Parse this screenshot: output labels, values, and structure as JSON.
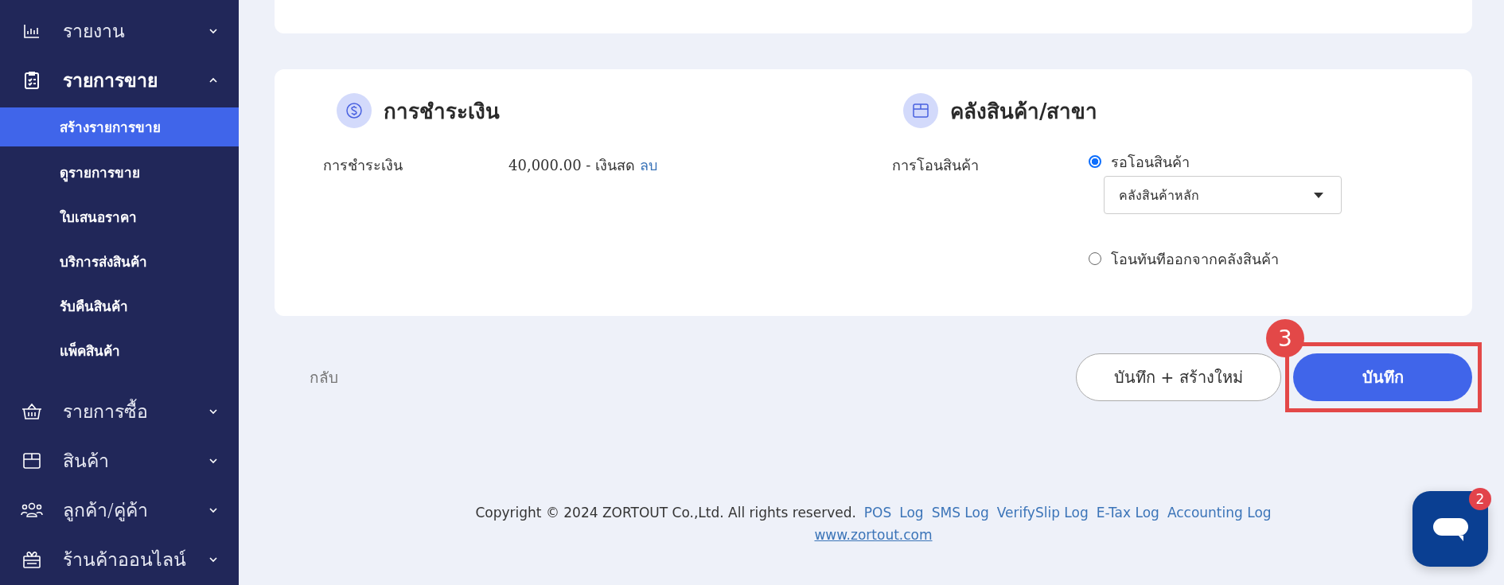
{
  "sidebar": {
    "items": [
      {
        "label": "รายงาน",
        "expanded": false
      },
      {
        "label": "รายการขาย",
        "expanded": true,
        "children": [
          {
            "label": "สร้างรายการขาย",
            "selected": true
          },
          {
            "label": "ดูรายการขาย",
            "selected": false
          },
          {
            "label": "ใบเสนอราคา",
            "selected": false
          },
          {
            "label": "บริการส่งสินค้า",
            "selected": false
          },
          {
            "label": "รับคืนสินค้า",
            "selected": false
          },
          {
            "label": "แพ็คสินค้า",
            "selected": false
          }
        ]
      },
      {
        "label": "รายการซื้อ",
        "expanded": false
      },
      {
        "label": "สินค้า",
        "expanded": false
      },
      {
        "label": "ลูกค้า/คู่ค้า",
        "expanded": false
      },
      {
        "label": "ร้านค้าออนไลน์",
        "expanded": false
      }
    ]
  },
  "payment": {
    "title": "การชำระเงิน",
    "label": "การชำระเงิน",
    "value": "40,000.00 - เงินสด",
    "delete_link": "ลบ"
  },
  "warehouse": {
    "title": "คลังสินค้า/สาขา",
    "label": "การโอนสินค้า",
    "options": [
      {
        "label": "รอโอนสินค้า",
        "selected": true,
        "select_value": "คลังสินค้าหลัก"
      },
      {
        "label": "โอนทันทีออกจากคลังสินค้า",
        "selected": false
      }
    ]
  },
  "actions": {
    "back": "กลับ",
    "save_new": "บันทึก + สร้างใหม่",
    "save": "บันทึก",
    "step_badge": "3"
  },
  "footer": {
    "copyright": "Copyright © 2024 ZORTOUT Co.,Ltd. All rights reserved.",
    "links": [
      "POS",
      "Log",
      "SMS Log",
      "VerifySlip Log",
      "E-Tax Log",
      "Accounting Log"
    ],
    "website": "www.zortout.com"
  },
  "chat": {
    "badge": "2"
  }
}
